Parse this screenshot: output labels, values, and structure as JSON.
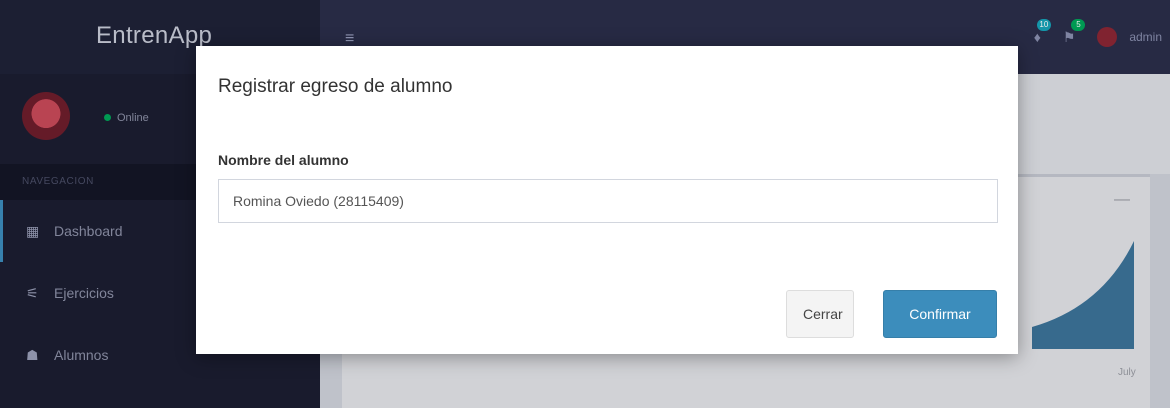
{
  "header": {
    "logo": "EntrenApp",
    "hamburger": "≡",
    "badges": {
      "notifications": "10",
      "tasks": "5"
    },
    "user_name": "admin"
  },
  "sidebar": {
    "status": "Online",
    "section": "NAVEGACION",
    "items": [
      {
        "label": "Dashboard",
        "icon": "dashboard-icon",
        "glyph": "▦"
      },
      {
        "label": "Ejercicios",
        "icon": "exercise-icon",
        "glyph": "⚟"
      },
      {
        "label": "Alumnos",
        "icon": "users-icon",
        "glyph": "☗"
      }
    ]
  },
  "chart": {
    "x_labels": [
      "",
      "July"
    ],
    "area_color": "#1f5f8b"
  },
  "modal": {
    "title": "Registrar egreso de alumno",
    "field_label": "Nombre del alumno",
    "field_value": "Romina Oviedo (28115409)",
    "close_label": "Cerrar",
    "confirm_label": "Confirmar"
  }
}
